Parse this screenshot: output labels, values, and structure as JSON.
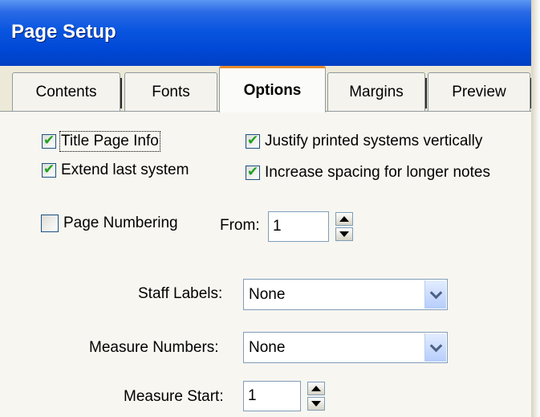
{
  "window": {
    "title": "Page Setup"
  },
  "tabs": [
    {
      "label": "Contents",
      "active": false
    },
    {
      "label": "Fonts",
      "active": false
    },
    {
      "label": "Options",
      "active": true
    },
    {
      "label": "Margins",
      "active": false
    },
    {
      "label": "Preview",
      "active": false
    }
  ],
  "options": {
    "title_page_info": {
      "label": "Title Page Info",
      "checked": true
    },
    "extend_last_system": {
      "label": "Extend last system",
      "checked": true
    },
    "justify_vertically": {
      "label": "Justify printed systems vertically",
      "checked": true
    },
    "increase_spacing": {
      "label": "Increase spacing for longer notes",
      "checked": true
    },
    "page_numbering": {
      "label": "Page Numbering",
      "checked": false
    },
    "from": {
      "label": "From:",
      "value": "1"
    },
    "staff_labels": {
      "label": "Staff Labels:",
      "value": "None"
    },
    "measure_numbers": {
      "label": "Measure Numbers:",
      "value": "None"
    },
    "measure_start": {
      "label": "Measure Start:",
      "value": "1"
    }
  },
  "colors": {
    "title_bar": "#0048d6",
    "active_tab_accent": "#e68b2c",
    "check_mark": "#21a121"
  },
  "icons": {
    "check": "check-icon",
    "spinner_up": "arrow-up-icon",
    "spinner_down": "arrow-down-icon",
    "dropdown": "chevron-down-icon"
  }
}
